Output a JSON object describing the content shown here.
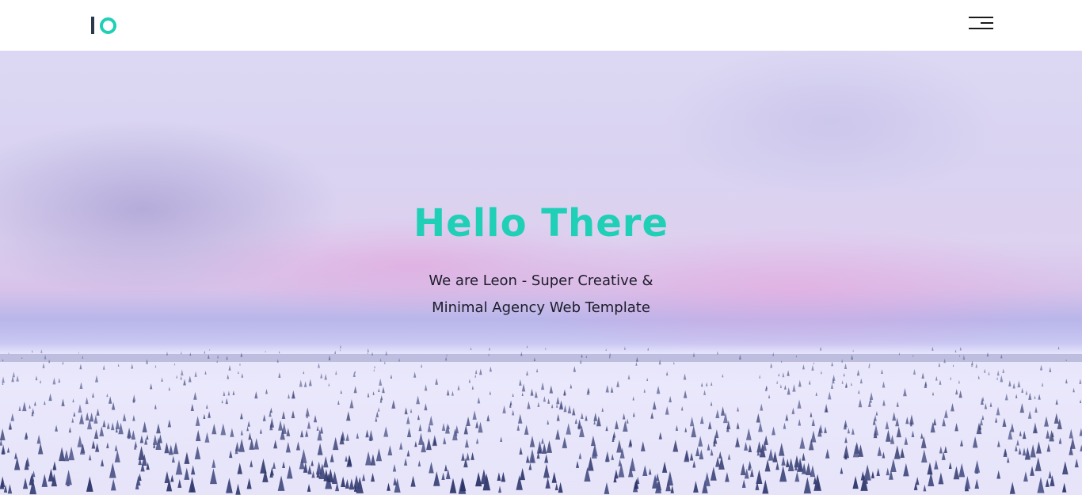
{
  "brand": {
    "logo_name": "io-logo",
    "accent_color": "#1fcfb6",
    "dark_color": "#2b3a4a"
  },
  "header": {
    "menu_icon": "hamburger-menu-icon"
  },
  "hero": {
    "title": "Hello There",
    "subtitle_line1": "We are Leon - Super Creative &",
    "subtitle_line2": "Minimal Agency Web Template",
    "background": "snowy forest landscape with pastel pink and lavender sky"
  }
}
